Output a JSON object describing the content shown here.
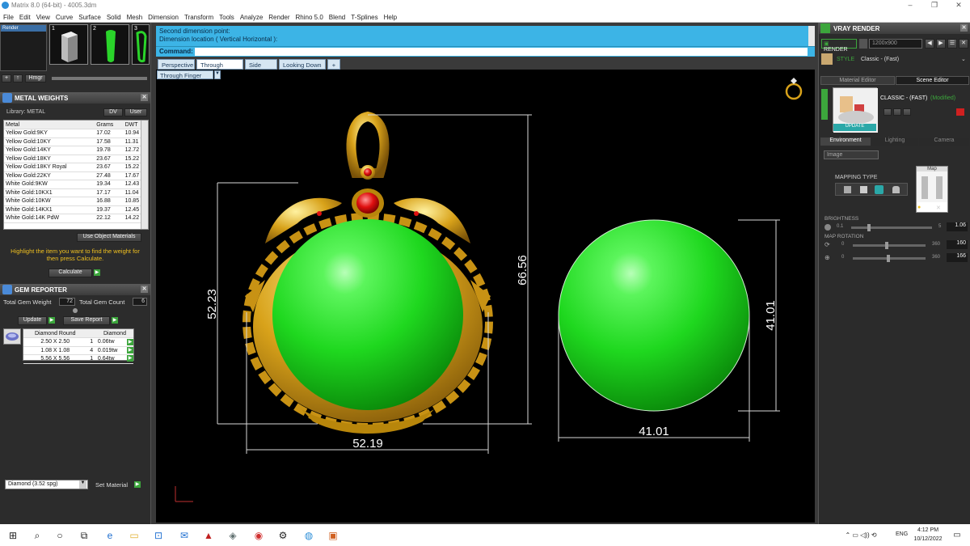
{
  "window": {
    "title": "Matrix 8.0 (64-bit) - 4005.3dm",
    "controls": [
      "–",
      "❐",
      "✕"
    ]
  },
  "menu": [
    "File",
    "Edit",
    "View",
    "Curve",
    "Surface",
    "Solid",
    "Mesh",
    "Dimension",
    "Transform",
    "Tools",
    "Analyze",
    "Render",
    "Rhino 5.0",
    "Blend",
    "T-Splines",
    "Help"
  ],
  "layers": {
    "row_label": "Render",
    "thumbs": [
      "1",
      "2",
      "3"
    ],
    "buttons": [
      "+",
      "↑",
      "Hmgr"
    ]
  },
  "metal_weights": {
    "title": "METAL WEIGHTS",
    "library_label": "Library: METAL",
    "toggles": [
      "DV",
      "User"
    ],
    "columns": [
      "Metal",
      "Grams",
      "DWT"
    ],
    "rows": [
      [
        "Yellow Gold:9KY",
        "17.02",
        "10.94"
      ],
      [
        "Yellow Gold:10KY",
        "17.58",
        "11.31"
      ],
      [
        "Yellow Gold:14KY",
        "19.78",
        "12.72"
      ],
      [
        "Yellow Gold:18KY",
        "23.67",
        "15.22"
      ],
      [
        "Yellow Gold:18KY Royal",
        "23.67",
        "15.22"
      ],
      [
        "Yellow Gold:22KY",
        "27.48",
        "17.67"
      ],
      [
        "White Gold:9KW",
        "19.34",
        "12.43"
      ],
      [
        "White Gold:10KX1",
        "17.17",
        "11.04"
      ],
      [
        "White Gold:10KW",
        "16.88",
        "10.85"
      ],
      [
        "White Gold:14KX1",
        "19.37",
        "12.45"
      ],
      [
        "White Gold:14K PdW",
        "22.12",
        "14.22"
      ]
    ],
    "use_object_materials": "Use Object Materials",
    "hint": "Highlight the item you want to find the weight for then press Calculate.",
    "calculate": "Calculate"
  },
  "gem_reporter": {
    "title": "GEM REPORTER",
    "total_weight_label": "Total Gem Weight",
    "total_weight_value": "72",
    "total_count_label": "Total Gem Count",
    "total_count_value": "6",
    "update": "Update",
    "save_report": "Save Report",
    "columns": [
      "Diamond Round",
      "",
      "Diamond"
    ],
    "rows": [
      [
        "2.50 X 2.50",
        "1",
        "0.06tw"
      ],
      [
        "1.08 X 1.08",
        "4",
        "0.019tw"
      ],
      [
        "5.56 X 5.56",
        "1",
        "0.64tw"
      ]
    ]
  },
  "material": {
    "selected": "Diamond    (3.52 spg)",
    "set_material": "Set Material"
  },
  "command": {
    "line1": "Second dimension point:",
    "line2": "Dimension location ( Vertical  Horizontal ):",
    "label": "Command:"
  },
  "viewport_tabs": [
    "Perspective",
    "Through Finger",
    "Side View",
    "Looking Down",
    "+"
  ],
  "viewport_label": "Through Finger",
  "dimensions": {
    "pendant_height": "52.23",
    "pendant_total_height": "66.56",
    "pendant_width": "52.19",
    "sphere_height": "41.01",
    "sphere_width": "41.01"
  },
  "vray": {
    "title": "VRAY RENDER",
    "render": "RENDER",
    "resolution": "1200x900",
    "style_label": "STYLE",
    "style_value": "Classic - (Fast)",
    "tabs": [
      "Material Editor",
      "Scene Editor"
    ],
    "preset": "CLASSIC - (FAST)",
    "modified": "(Modified)",
    "update": "UPDATE",
    "env_tabs": [
      "Environment",
      "Lighting",
      "Camera"
    ],
    "image_select": "Image",
    "mapping_type": "MAPPING TYPE",
    "map_label": "Map",
    "brightness": "BRIGHTNESS",
    "brightness_min": "0.1",
    "brightness_max": "5",
    "brightness_value": "1.06",
    "map_rotation": "MAP ROTATION",
    "rot_min": "0",
    "rot_max": "360",
    "rot1_value": "160",
    "rot2_value": "166"
  },
  "taskbar": {
    "lang": "ENG",
    "time": "4:12 PM",
    "date": "10/12/2022"
  },
  "colors": {
    "command_bg": "#3cb4e6",
    "sphere_green": "#22e022",
    "gold": "#d4a017",
    "ruby": "#e01010"
  }
}
